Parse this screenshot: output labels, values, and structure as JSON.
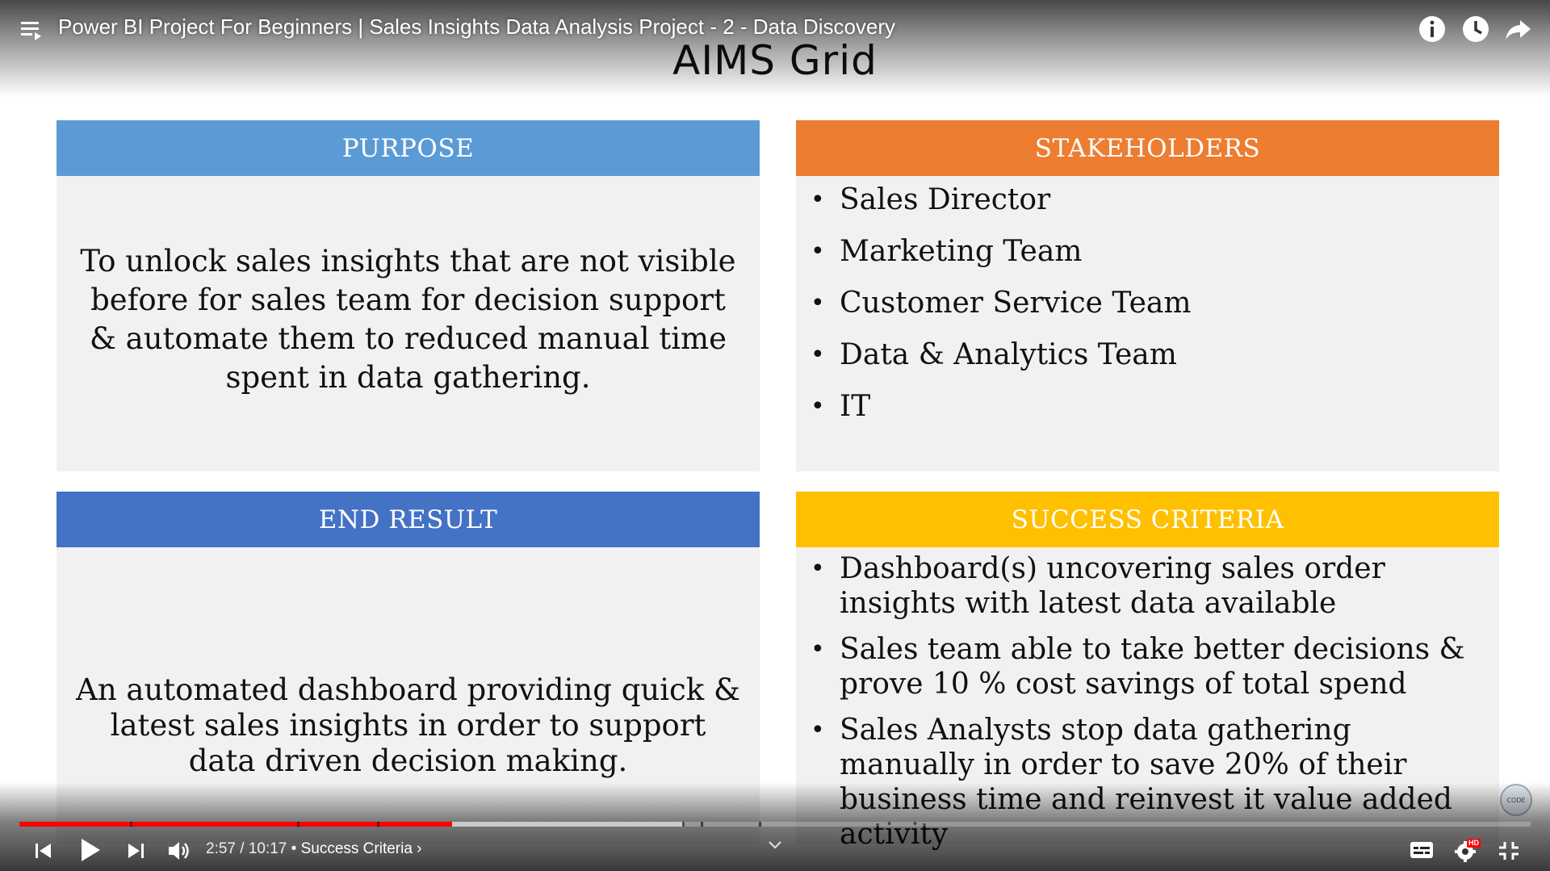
{
  "video": {
    "title": "Power BI Project For Beginners | Sales Insights Data Analysis Project - 2 - Data Discovery",
    "current_time": "2:57",
    "separator": " / ",
    "duration": "10:17",
    "chapter": " • Success Criteria ›",
    "progress_fraction": 0.2865,
    "buffered_fraction": 0.44
  },
  "slide": {
    "title": "AIMS Grid",
    "purpose": {
      "header": "PURPOSE",
      "color": "#5b9bd5",
      "text": "To unlock sales insights that are not visible before for sales team for decision support & automate them to reduced manual time spent in data gathering."
    },
    "stakeholders": {
      "header": "STAKEHOLDERS",
      "color": "#ed7d31",
      "items": [
        "Sales Director",
        "Marketing Team",
        "Customer Service Team",
        "Data & Analytics Team",
        "IT"
      ]
    },
    "end_result": {
      "header": "END RESULT",
      "color": "#4472c4",
      "text": "An automated dashboard providing quick & latest sales insights in order to support data driven decision making."
    },
    "success_criteria": {
      "header": "SUCCESS CRITERIA",
      "color": "#ffc000",
      "items": [
        "Dashboard(s) uncovering sales order insights with latest data available",
        "Sales team able to take better decisions & prove 10 % cost savings of total spend",
        "Sales Analysts stop data gathering manually in order to save 20% of their business time and reinvest it value added activity"
      ]
    }
  },
  "icons": {
    "playlist": "playlist-icon",
    "info": "info-icon",
    "watch_later": "clock-icon",
    "share": "share-icon",
    "previous": "previous-icon",
    "play": "play-icon",
    "next": "next-icon",
    "volume": "volume-icon",
    "subtitles": "subtitles-icon",
    "settings": "settings-icon",
    "exit_fullscreen": "exit-fullscreen-icon",
    "chevron": "chevron-down-icon"
  },
  "badges": {
    "hd": "HD"
  },
  "colors": {
    "progress_played": "#ff0000"
  }
}
